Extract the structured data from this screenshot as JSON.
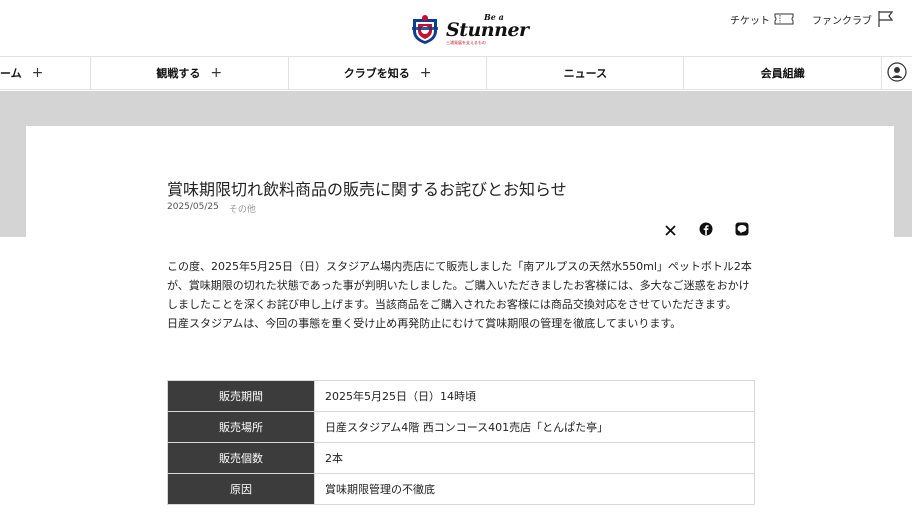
{
  "header": {
    "logo": {
      "small": "Be a",
      "main": "Stunner",
      "sub": "三浦発展を支えるもの"
    },
    "util_links": [
      {
        "label": "チケット",
        "icon": "ticket-icon"
      },
      {
        "label": "ファンクラブ",
        "icon": "flag-icon"
      }
    ]
  },
  "nav": {
    "items": [
      {
        "label": "ーム",
        "has_plus": true
      },
      {
        "label": "観戦する",
        "has_plus": true
      },
      {
        "label": "クラブを知る",
        "has_plus": true
      },
      {
        "label": "ニュース",
        "has_plus": false
      },
      {
        "label": "会員組織",
        "has_plus": false
      }
    ],
    "plus": "+"
  },
  "article": {
    "title": "賞味期限切れ飲料商品の販売に関するお詫びとお知らせ",
    "date": "2025/05/25",
    "category": "その他",
    "share": [
      "x-icon",
      "facebook-icon",
      "line-icon"
    ],
    "paragraphs": [
      "この度、2025年5月25日（日）スタジアム場内売店にて販売しました「南アルプスの天然水550ml」ペットボトル2本が、賞味期限の切れた状態であった事が判明いたしました。ご購入いただきましたお客様には、多大なご迷惑をおかけしましたことを深くお詫び申し上げます。当該商品をご購入されたお客様には商品交換対応をさせていただきます。",
      "日産スタジアムは、今回の事態を重く受け止め再発防止にむけて賞味期限の管理を徹底してまいります。"
    ],
    "table": [
      {
        "label": "販売期間",
        "value": "2025年5月25日（日）14時頃"
      },
      {
        "label": "販売場所",
        "value": "日産スタジアム4階 西コンコース401売店「とんぱた亭」"
      },
      {
        "label": "販売個数",
        "value": "2本"
      },
      {
        "label": "原因",
        "value": "賞味期限管理の不徹底"
      }
    ]
  }
}
